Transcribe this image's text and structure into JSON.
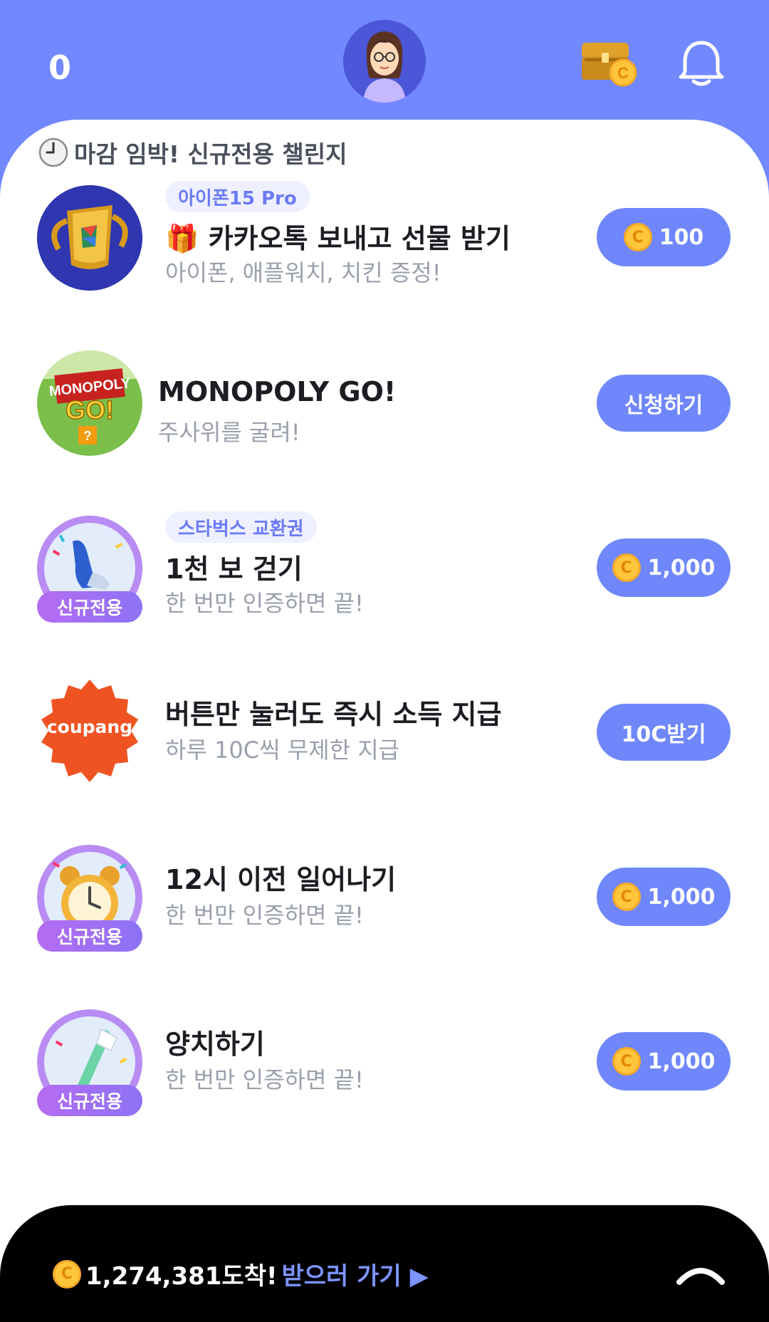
{
  "header": {
    "coin_count": "0"
  },
  "section": {
    "title": "마감 임박! 신규전용 챌린지"
  },
  "items": [
    {
      "tag": "아이폰15 Pro",
      "title": "카카오톡 보내고 선물 받기",
      "subtitle": "아이폰, 애플워치, 치킨 증정!",
      "cta": "100",
      "cta_coin": true,
      "thumb_icon": "trophy-icon"
    },
    {
      "title": "MONOPOLY GO!",
      "subtitle": "주사위를 굴려!",
      "cta": "신청하기",
      "thumb_icon": "monopoly-icon"
    },
    {
      "tag": "스타벅스 교환권",
      "badge": "신규전용",
      "title": "1천 보 걷기",
      "subtitle": "한 번만 인증하면 끝!",
      "cta": "1,000",
      "cta_coin": true,
      "thumb_icon": "shoe-icon"
    },
    {
      "title": "버튼만 눌러도 즉시 소득 지급",
      "subtitle": "하루 10C씩 무제한 지급",
      "cta": "10C받기",
      "thumb_text": "coupang",
      "thumb_icon": "coupang-logo"
    },
    {
      "badge": "신규전용",
      "title": "12시 이전 일어나기",
      "subtitle": "한 번만 인증하면 끝!",
      "cta": "1,000",
      "cta_coin": true,
      "thumb_icon": "alarm-clock-icon"
    },
    {
      "badge": "신규전용",
      "title": "양치하기",
      "subtitle": "한 번만 인증하면 끝!",
      "cta": "1,000",
      "cta_coin": true,
      "thumb_icon": "toothbrush-icon"
    }
  ],
  "bottom_bar": {
    "amount_text": "1,274,381도착!",
    "link_text": "받으러 가기 ▶"
  },
  "coin_symbol": "C",
  "colors": {
    "brand": "#7188ff",
    "cta": "#6f87fb",
    "coin": "#ffc53d",
    "badge": "#b56cf2"
  }
}
